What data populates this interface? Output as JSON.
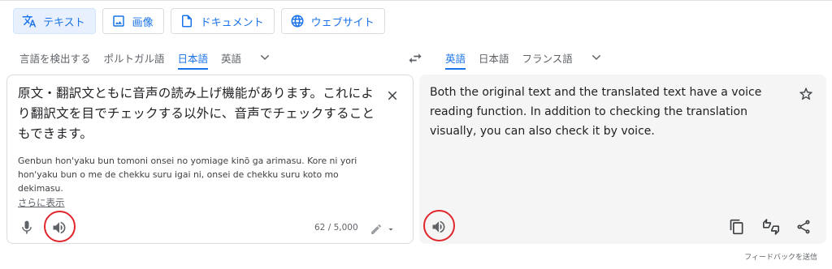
{
  "mode_tabs": [
    {
      "label": "テキスト",
      "icon": "translate-icon",
      "active": true
    },
    {
      "label": "画像",
      "icon": "image-icon",
      "active": false
    },
    {
      "label": "ドキュメント",
      "icon": "document-icon",
      "active": false
    },
    {
      "label": "ウェブサイト",
      "icon": "globe-icon",
      "active": false
    }
  ],
  "source_langs": [
    "言語を検出する",
    "ポルトガル語",
    "日本語",
    "英語"
  ],
  "source_active_index": 2,
  "target_langs": [
    "英語",
    "日本語",
    "フランス語"
  ],
  "target_active_index": 0,
  "source": {
    "text": "原文・翻訳文ともに音声の読み上げ機能があります。これにより翻訳文を目でチェックする以外に、音声でチェックすることもできます。",
    "transliteration": "Genbun hon'yaku bun tomoni onsei no yomiage kinō ga arimasu. Kore ni yori hon'yaku bun o me de chekku suru igai ni, onsei de chekku suru koto mo dekimasu.",
    "more_link": "さらに表示",
    "char_count": "62 / 5,000"
  },
  "target": {
    "text": "Both the original text and the translated text have a voice reading function. In addition to checking the translation visually, you can also check it by voice."
  },
  "feedback": "フィードバックを送信",
  "colors": {
    "accent": "#1a73e8",
    "highlight_ring": "#e0252c",
    "target_panel_bg": "#f5f5f5"
  }
}
